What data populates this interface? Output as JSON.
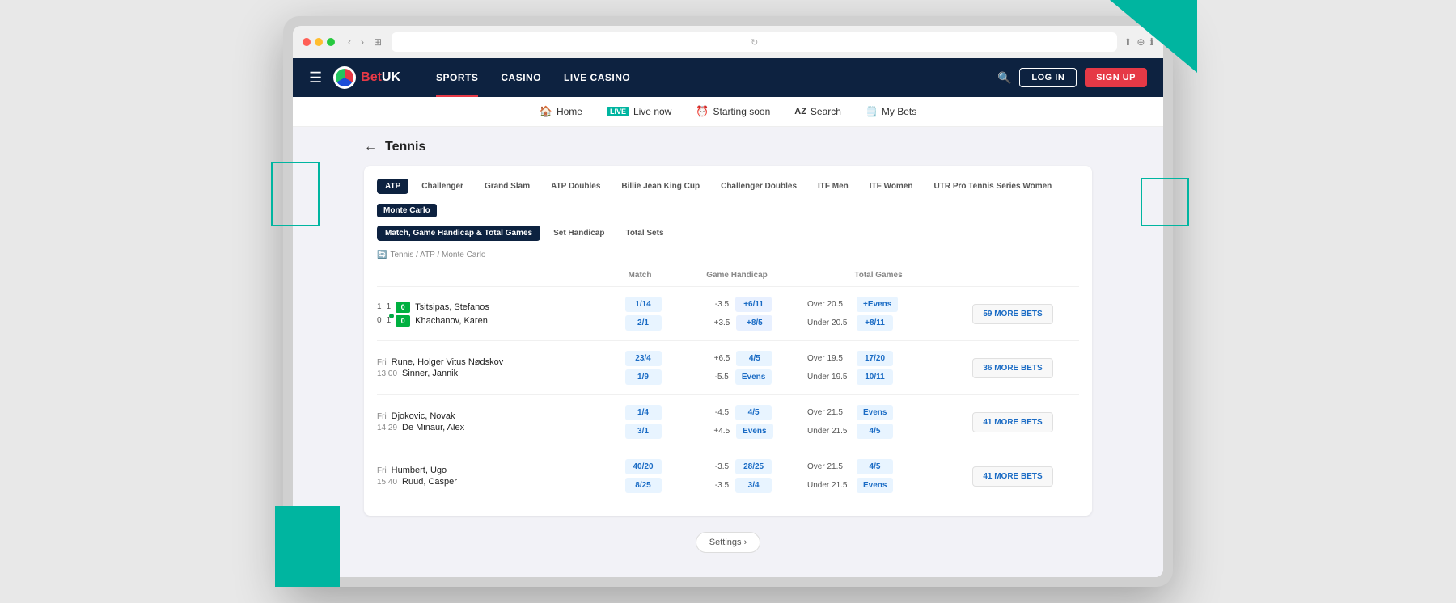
{
  "browser": {
    "url": ""
  },
  "nav": {
    "brand": "BetUK",
    "brand_accent": "Bet",
    "links": [
      {
        "label": "SPORTS",
        "active": true
      },
      {
        "label": "CASINO",
        "active": false
      },
      {
        "label": "LIVE CASINO",
        "active": false
      }
    ],
    "login_label": "LOG IN",
    "signup_label": "SIGN UP"
  },
  "subnav": {
    "items": [
      {
        "label": "Home",
        "icon": "🏠"
      },
      {
        "label": "Live now",
        "icon": "LIVE",
        "is_live": true
      },
      {
        "label": "Starting soon",
        "icon": "⏰"
      },
      {
        "label": "Search",
        "icon": "AZ"
      },
      {
        "label": "My Bets",
        "icon": "🗒️"
      }
    ]
  },
  "page": {
    "title": "Tennis",
    "breadcrumb": "Tennis / ATP / Monte Carlo",
    "tour_tabs": [
      {
        "label": "ATP",
        "active": true
      },
      {
        "label": "Challenger",
        "active": false
      },
      {
        "label": "Grand Slam",
        "active": false
      },
      {
        "label": "ATP Doubles",
        "active": false
      },
      {
        "label": "Billie Jean King Cup",
        "active": false
      },
      {
        "label": "Challenger Doubles",
        "active": false
      },
      {
        "label": "ITF Men",
        "active": false
      },
      {
        "label": "ITF Women",
        "active": false
      },
      {
        "label": "UTR Pro Tennis Series Women",
        "active": false
      }
    ],
    "tournament": "Monte Carlo",
    "market_tabs": [
      {
        "label": "Match, Game Handicap & Total Games",
        "active": true
      },
      {
        "label": "Set Handicap",
        "active": false
      },
      {
        "label": "Total Sets",
        "active": false
      }
    ],
    "columns": {
      "match": "Match",
      "handicap": "Game Handicap",
      "total": "Total Games"
    },
    "matches": [
      {
        "live": true,
        "time": "",
        "p1": {
          "name": "Tsitsipas, Stefanos",
          "score": "0",
          "set_scores": [
            1,
            1
          ]
        },
        "p2": {
          "name": "Khachanov, Karen",
          "score": "0",
          "set_scores": [
            0,
            1
          ],
          "serving": true
        },
        "match_odds": {
          "p1": "1/14",
          "p2": "2/1"
        },
        "handicap": {
          "p1_val": "-3.5",
          "p1_odds": "+6/11",
          "p2_val": "+3.5",
          "p2_odds": "+8/5"
        },
        "total": {
          "over_val": "20.5",
          "over_odds": "+Evens",
          "under_val": "20.5",
          "under_odds": "+8/11"
        },
        "more_bets": "59 MORE BETS"
      },
      {
        "live": false,
        "time_day": "Fri",
        "time_hour": "13:00",
        "p1": {
          "name": "Rune, Holger Vitus Nødskov"
        },
        "p2": {
          "name": "Sinner, Jannik"
        },
        "match_odds": {
          "p1": "23/4",
          "p2": "1/9"
        },
        "handicap": {
          "p1_val": "+6.5",
          "p1_odds": "4/5",
          "p2_val": "-5.5",
          "p2_odds": "Evens"
        },
        "total": {
          "over_val": "19.5",
          "over_odds": "17/20",
          "under_val": "19.5",
          "under_odds": "10/11"
        },
        "more_bets": "36 MORE BETS"
      },
      {
        "live": false,
        "time_day": "Fri",
        "time_hour": "14:29",
        "p1": {
          "name": "Djokovic, Novak"
        },
        "p2": {
          "name": "De Minaur, Alex"
        },
        "match_odds": {
          "p1": "1/4",
          "p2": "3/1"
        },
        "handicap": {
          "p1_val": "-4.5",
          "p1_odds": "4/5",
          "p2_val": "+4.5",
          "p2_odds": "Evens"
        },
        "total": {
          "over_val": "21.5",
          "over_odds": "Evens",
          "under_val": "21.5",
          "under_odds": "4/5"
        },
        "more_bets": "41 MORE BETS"
      },
      {
        "live": false,
        "time_day": "Fri",
        "time_hour": "15:40",
        "p1": {
          "name": "Humbert, Ugo"
        },
        "p2": {
          "name": "Ruud, Casper"
        },
        "match_odds": {
          "p1": "40/20",
          "p2": "8/25"
        },
        "handicap": {
          "p1_val": "-3.5",
          "p1_odds": "28/25",
          "p2_val": "-3.5",
          "p2_odds": "3/4"
        },
        "total": {
          "over_val": "21.5",
          "over_odds": "4/5",
          "under_val": "21.5",
          "under_odds": "Evens"
        },
        "more_bets": "41 MORE BETS"
      }
    ],
    "settings_label": "Settings ›"
  }
}
